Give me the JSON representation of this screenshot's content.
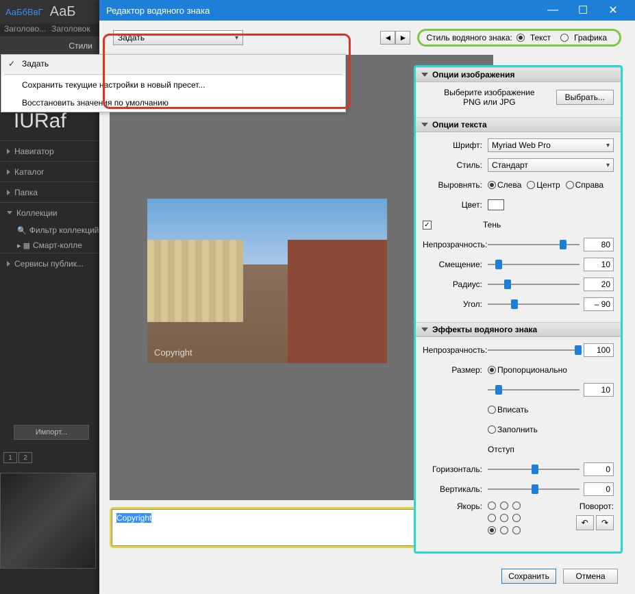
{
  "bg": {
    "aa1": "АаБбВвГ",
    "aa2": "АаБ",
    "header1": "Заголово...",
    "header2": "Заголовок",
    "styles_label": "Стили",
    "brand": "IURaf",
    "nav": [
      "Навигатор",
      "Каталог",
      "Папка",
      "Коллекции",
      "Сервисы публик..."
    ],
    "filter": "Фильтр коллекций",
    "smart": "Смарт-колле",
    "import_btn": "Импорт...",
    "toggle": [
      "1",
      "2"
    ]
  },
  "dialog": {
    "title": "Редактор водяного знака",
    "preset_value": "Задать",
    "dropdown": {
      "items": [
        "Задать",
        "Сохранить текущие настройки в новый пресет...",
        "Восстановить значения по умолчанию"
      ]
    },
    "style_label": "Стиль водяного знака:",
    "style_text": "Текст",
    "style_graphic": "Графика",
    "preview_copyright": "Copyright",
    "text_value": "Copyright",
    "footer": {
      "save": "Сохранить",
      "cancel": "Отмена"
    }
  },
  "panel": {
    "img_section": "Опции изображения",
    "img_hint1": "Выберите изображение",
    "img_hint2": "PNG или JPG",
    "choose_btn": "Выбрать...",
    "text_section": "Опции текста",
    "font_label": "Шрифт:",
    "font_value": "Myriad Web Pro",
    "style_label": "Стиль:",
    "style_value": "Стандарт",
    "align_label": "Выровнять:",
    "align_left": "Слева",
    "align_center": "Центр",
    "align_right": "Справа",
    "color_label": "Цвет:",
    "shadow_label": "Тень",
    "opacity_label": "Непрозрачность:",
    "opacity_val": "80",
    "offset_label": "Смещение:",
    "offset_val": "10",
    "radius_label": "Радиус:",
    "radius_val": "20",
    "angle_label": "Угол:",
    "angle_val": "– 90",
    "fx_section": "Эффекты водяного знака",
    "fx_opacity": "Непрозрачность:",
    "fx_opacity_val": "100",
    "size_label": "Размер:",
    "size_prop": "Пропорционально",
    "size_val": "10",
    "size_fit": "Вписать",
    "size_fill": "Заполнить",
    "inset_label": "Отступ",
    "hor_label": "Горизонталь:",
    "hor_val": "0",
    "ver_label": "Вертикаль:",
    "ver_val": "0",
    "anchor_label": "Якорь:",
    "rotate_label": "Поворот:"
  }
}
